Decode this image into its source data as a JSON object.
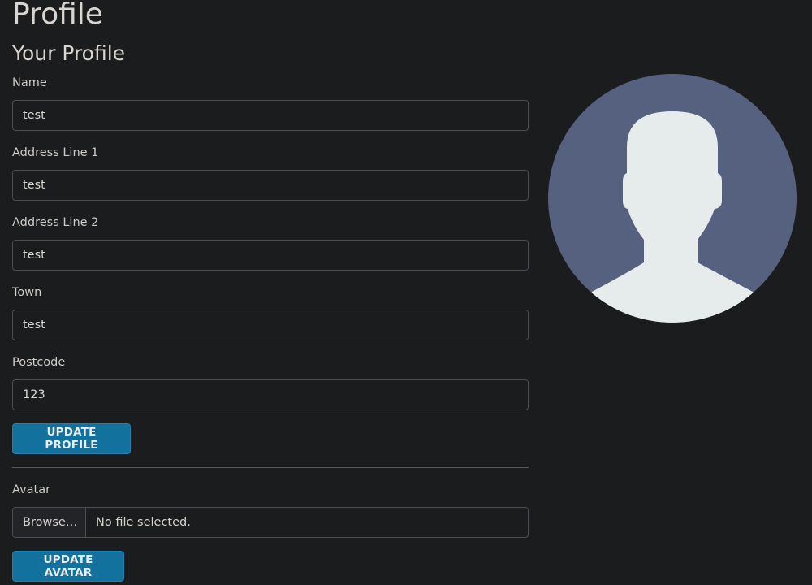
{
  "page": {
    "title": "Profile"
  },
  "profile": {
    "heading": "Your Profile",
    "fields": {
      "name": {
        "label": "Name",
        "value": "test"
      },
      "address1": {
        "label": "Address Line 1",
        "value": "test"
      },
      "address2": {
        "label": "Address Line 2",
        "value": "test"
      },
      "town": {
        "label": "Town",
        "value": "test"
      },
      "postcode": {
        "label": "Postcode",
        "value": "123"
      }
    },
    "update_button": "UPDATE PROFILE"
  },
  "avatar": {
    "label": "Avatar",
    "browse_label": "Browse…",
    "file_status": "No file selected.",
    "update_button": "UPDATE AVATAR",
    "image_icon": "default-user-silhouette-icon"
  },
  "colors": {
    "background": "#1b1c1e",
    "accent_button": "#12719d",
    "avatar_circle": "#56617f",
    "avatar_silhouette": "#e6ecec"
  }
}
